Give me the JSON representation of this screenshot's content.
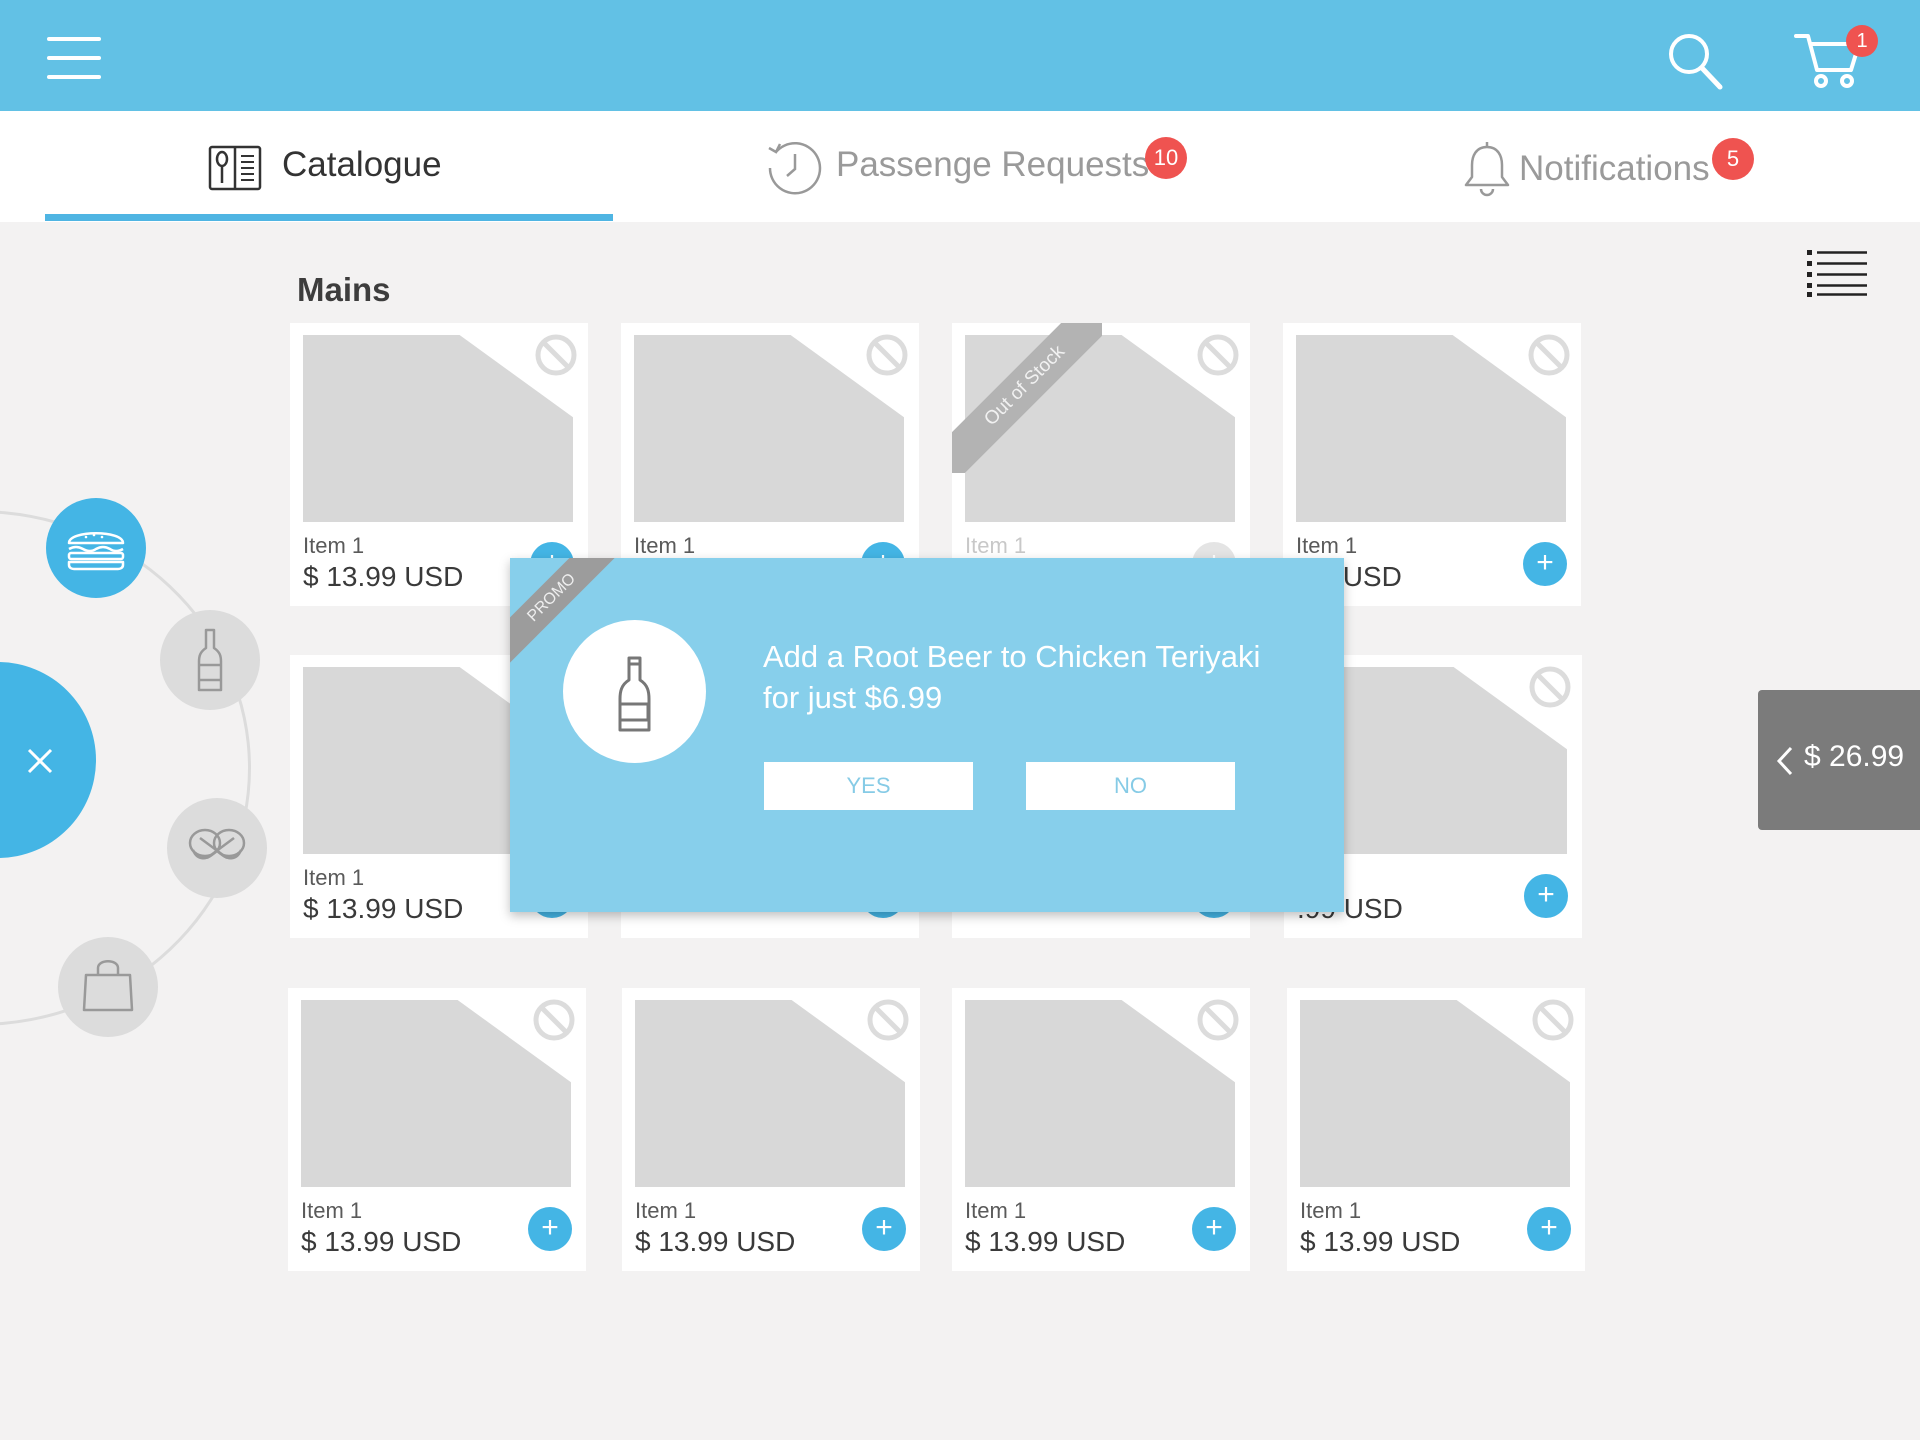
{
  "header": {
    "cart_count": "1"
  },
  "tabs": [
    {
      "label": "Catalogue"
    },
    {
      "label": "Passenge Requests",
      "badge": "10"
    },
    {
      "label": "Notifications",
      "badge": "5"
    }
  ],
  "section": {
    "title": "Mains"
  },
  "products": [
    {
      "name": "Item 1",
      "price": "$ 13.99 USD"
    },
    {
      "name": "Item 1",
      "price": ""
    },
    {
      "name": "Item 1",
      "price": "",
      "status": "Out of Stock"
    },
    {
      "name": "Item 1",
      "price": ".99 USD"
    },
    {
      "name": "Item 1",
      "price": "$ 13.99 USD"
    },
    {
      "name": "",
      "price": ""
    },
    {
      "name": "",
      "price": ""
    },
    {
      "name": "1",
      "price": ".99 USD"
    },
    {
      "name": "Item 1",
      "price": "$ 13.99 USD"
    },
    {
      "name": "Item 1",
      "price": "$ 13.99 USD"
    },
    {
      "name": "Item 1",
      "price": "$ 13.99 USD"
    },
    {
      "name": "Item 1",
      "price": "$ 13.99 USD"
    }
  ],
  "add_label": "+",
  "categories": [
    {
      "icon": "burger-icon",
      "active": true
    },
    {
      "icon": "bottle-icon",
      "active": false
    },
    {
      "icon": "pretzel-icon",
      "active": false
    },
    {
      "icon": "shopping-bag-icon",
      "active": false
    }
  ],
  "cart_total": "$ 26.99",
  "promo": {
    "ribbon": "PROMO",
    "line1": "Add a Root Beer to Chicken Teriyaki",
    "line2": "for just $6.99",
    "yes_label": "YES",
    "no_label": "NO"
  },
  "colors": {
    "primary": "#62c1e5",
    "accent": "#44b5e5",
    "badge": "#ef5350",
    "modal": "#87cfeb"
  }
}
